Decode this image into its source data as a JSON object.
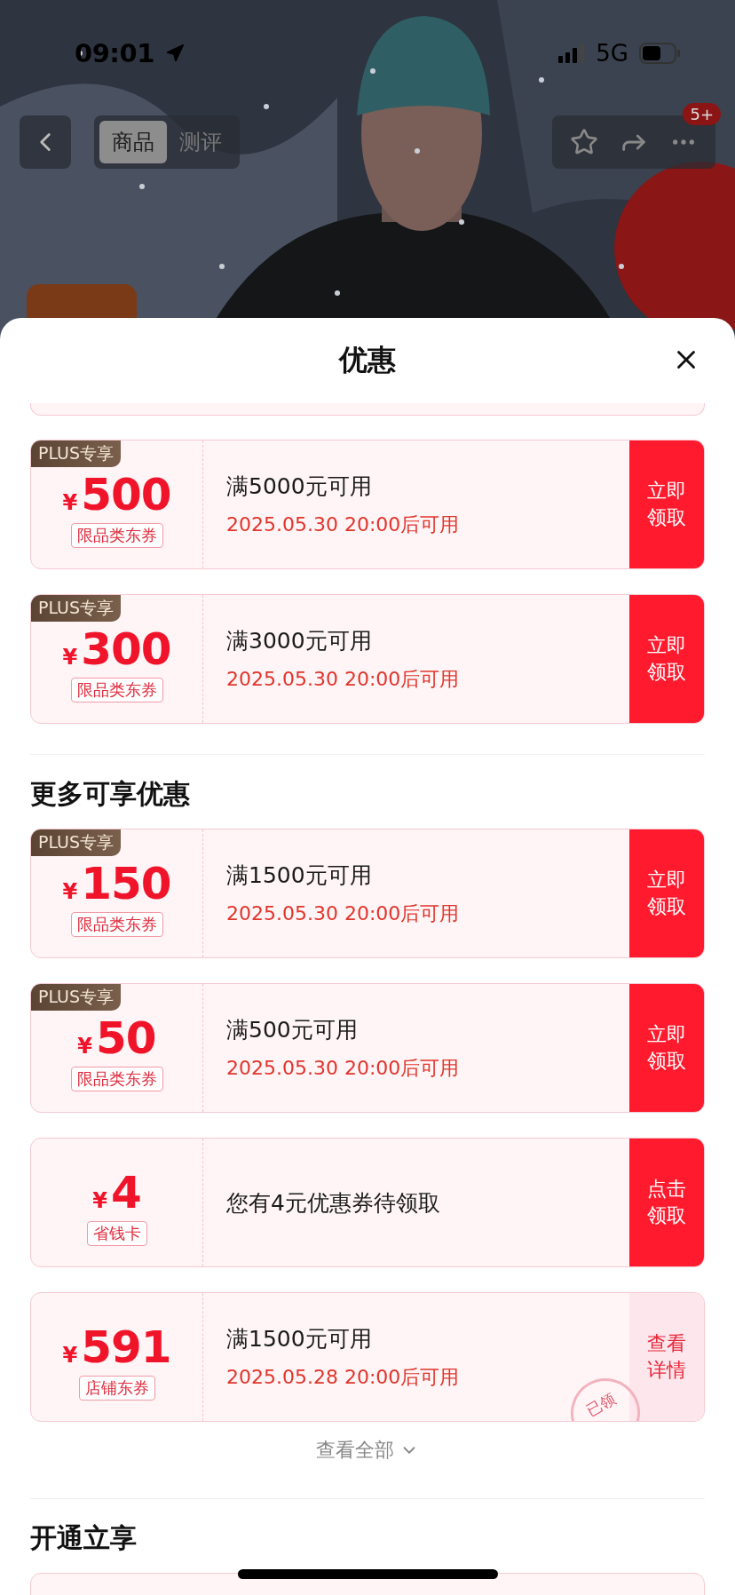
{
  "status_bar": {
    "time": "09:01",
    "network": "5G"
  },
  "nav": {
    "tabs": [
      {
        "label": "商品",
        "selected": true
      },
      {
        "label": "测评",
        "selected": false
      }
    ],
    "badge": "5+"
  },
  "title": "优惠",
  "coupons": [
    {
      "kind": "claim",
      "tag": "PLUS专享",
      "currency": "¥",
      "amount": "500",
      "category": "限品类东券",
      "condition": "满5000元可用",
      "note": "2025.05.30 20:00后可用",
      "action": "立即领取",
      "claimed": false
    },
    {
      "kind": "claim",
      "tag": "PLUS专享",
      "currency": "¥",
      "amount": "300",
      "category": "限品类东券",
      "condition": "满3000元可用",
      "note": "2025.05.30 20:00后可用",
      "action": "立即领取",
      "claimed": false
    }
  ],
  "more_section": {
    "title": "更多可享优惠",
    "coupons": [
      {
        "kind": "claim",
        "tag": "PLUS专享",
        "currency": "¥",
        "amount": "150",
        "category": "限品类东券",
        "condition": "满1500元可用",
        "note": "2025.05.30 20:00后可用",
        "action": "立即领取",
        "claimed": false
      },
      {
        "kind": "claim",
        "tag": "PLUS专享",
        "currency": "¥",
        "amount": "50",
        "category": "限品类东券",
        "condition": "满500元可用",
        "note": "2025.05.30 20:00后可用",
        "action": "立即领取",
        "claimed": false
      },
      {
        "kind": "claim",
        "currency": "¥",
        "amount": "4",
        "category": "省钱卡",
        "condition": "您有4元优惠券待领取",
        "action": "点击领取",
        "claimed": false
      },
      {
        "kind": "details",
        "currency": "¥",
        "amount": "591",
        "category": "店铺东券",
        "condition": "满1500元可用",
        "note": "2025.05.28 20:00后可用",
        "action": "查看详情",
        "claimed": true,
        "stamp": "已领"
      }
    ],
    "view_all": "查看全部"
  },
  "next_section": {
    "title": "开通立享"
  }
}
